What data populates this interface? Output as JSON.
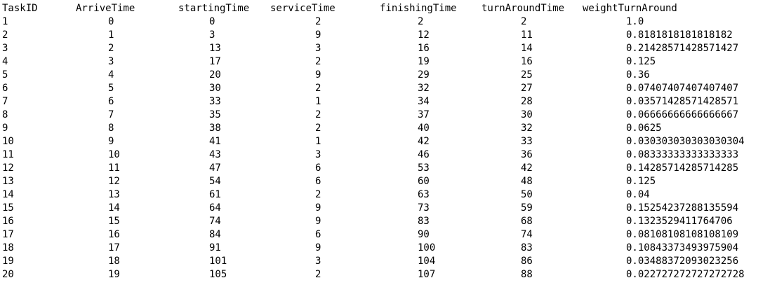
{
  "headers": {
    "task_id": "TaskID",
    "arrive_time": "ArriveTime",
    "starting_time": "startingTime",
    "service_time": "serviceTime",
    "finishing_time": "finishingTime",
    "turnaround_time": "turnAroundTime",
    "weight_turnaround": "weightTurnAround"
  },
  "rows": [
    [
      "1",
      "0",
      "0",
      "2",
      "2",
      "2",
      "1.0"
    ],
    [
      "2",
      "1",
      "3",
      "9",
      "12",
      "11",
      "0.8181818181818182"
    ],
    [
      "3",
      "2",
      "13",
      "3",
      "16",
      "14",
      "0.21428571428571427"
    ],
    [
      "4",
      "3",
      "17",
      "2",
      "19",
      "16",
      "0.125"
    ],
    [
      "5",
      "4",
      "20",
      "9",
      "29",
      "25",
      "0.36"
    ],
    [
      "6",
      "5",
      "30",
      "2",
      "32",
      "27",
      "0.07407407407407407"
    ],
    [
      "7",
      "6",
      "33",
      "1",
      "34",
      "28",
      "0.03571428571428571"
    ],
    [
      "8",
      "7",
      "35",
      "2",
      "37",
      "30",
      "0.06666666666666667"
    ],
    [
      "9",
      "8",
      "38",
      "2",
      "40",
      "32",
      "0.0625"
    ],
    [
      "10",
      "9",
      "41",
      "1",
      "42",
      "33",
      "0.030303030303030304"
    ],
    [
      "11",
      "10",
      "43",
      "3",
      "46",
      "36",
      "0.08333333333333333"
    ],
    [
      "12",
      "11",
      "47",
      "6",
      "53",
      "42",
      "0.14285714285714285"
    ],
    [
      "13",
      "12",
      "54",
      "6",
      "60",
      "48",
      "0.125"
    ],
    [
      "14",
      "13",
      "61",
      "2",
      "63",
      "50",
      "0.04"
    ],
    [
      "15",
      "14",
      "64",
      "9",
      "73",
      "59",
      "0.15254237288135594"
    ],
    [
      "16",
      "15",
      "74",
      "9",
      "83",
      "68",
      "0.1323529411764706"
    ],
    [
      "17",
      "16",
      "84",
      "6",
      "90",
      "74",
      "0.08108108108108109"
    ],
    [
      "18",
      "17",
      "91",
      "9",
      "100",
      "83",
      "0.10843373493975904"
    ],
    [
      "19",
      "18",
      "101",
      "3",
      "104",
      "86",
      "0.03488372093023256"
    ],
    [
      "20",
      "19",
      "105",
      "2",
      "107",
      "88",
      "0.022727272727272728"
    ]
  ]
}
